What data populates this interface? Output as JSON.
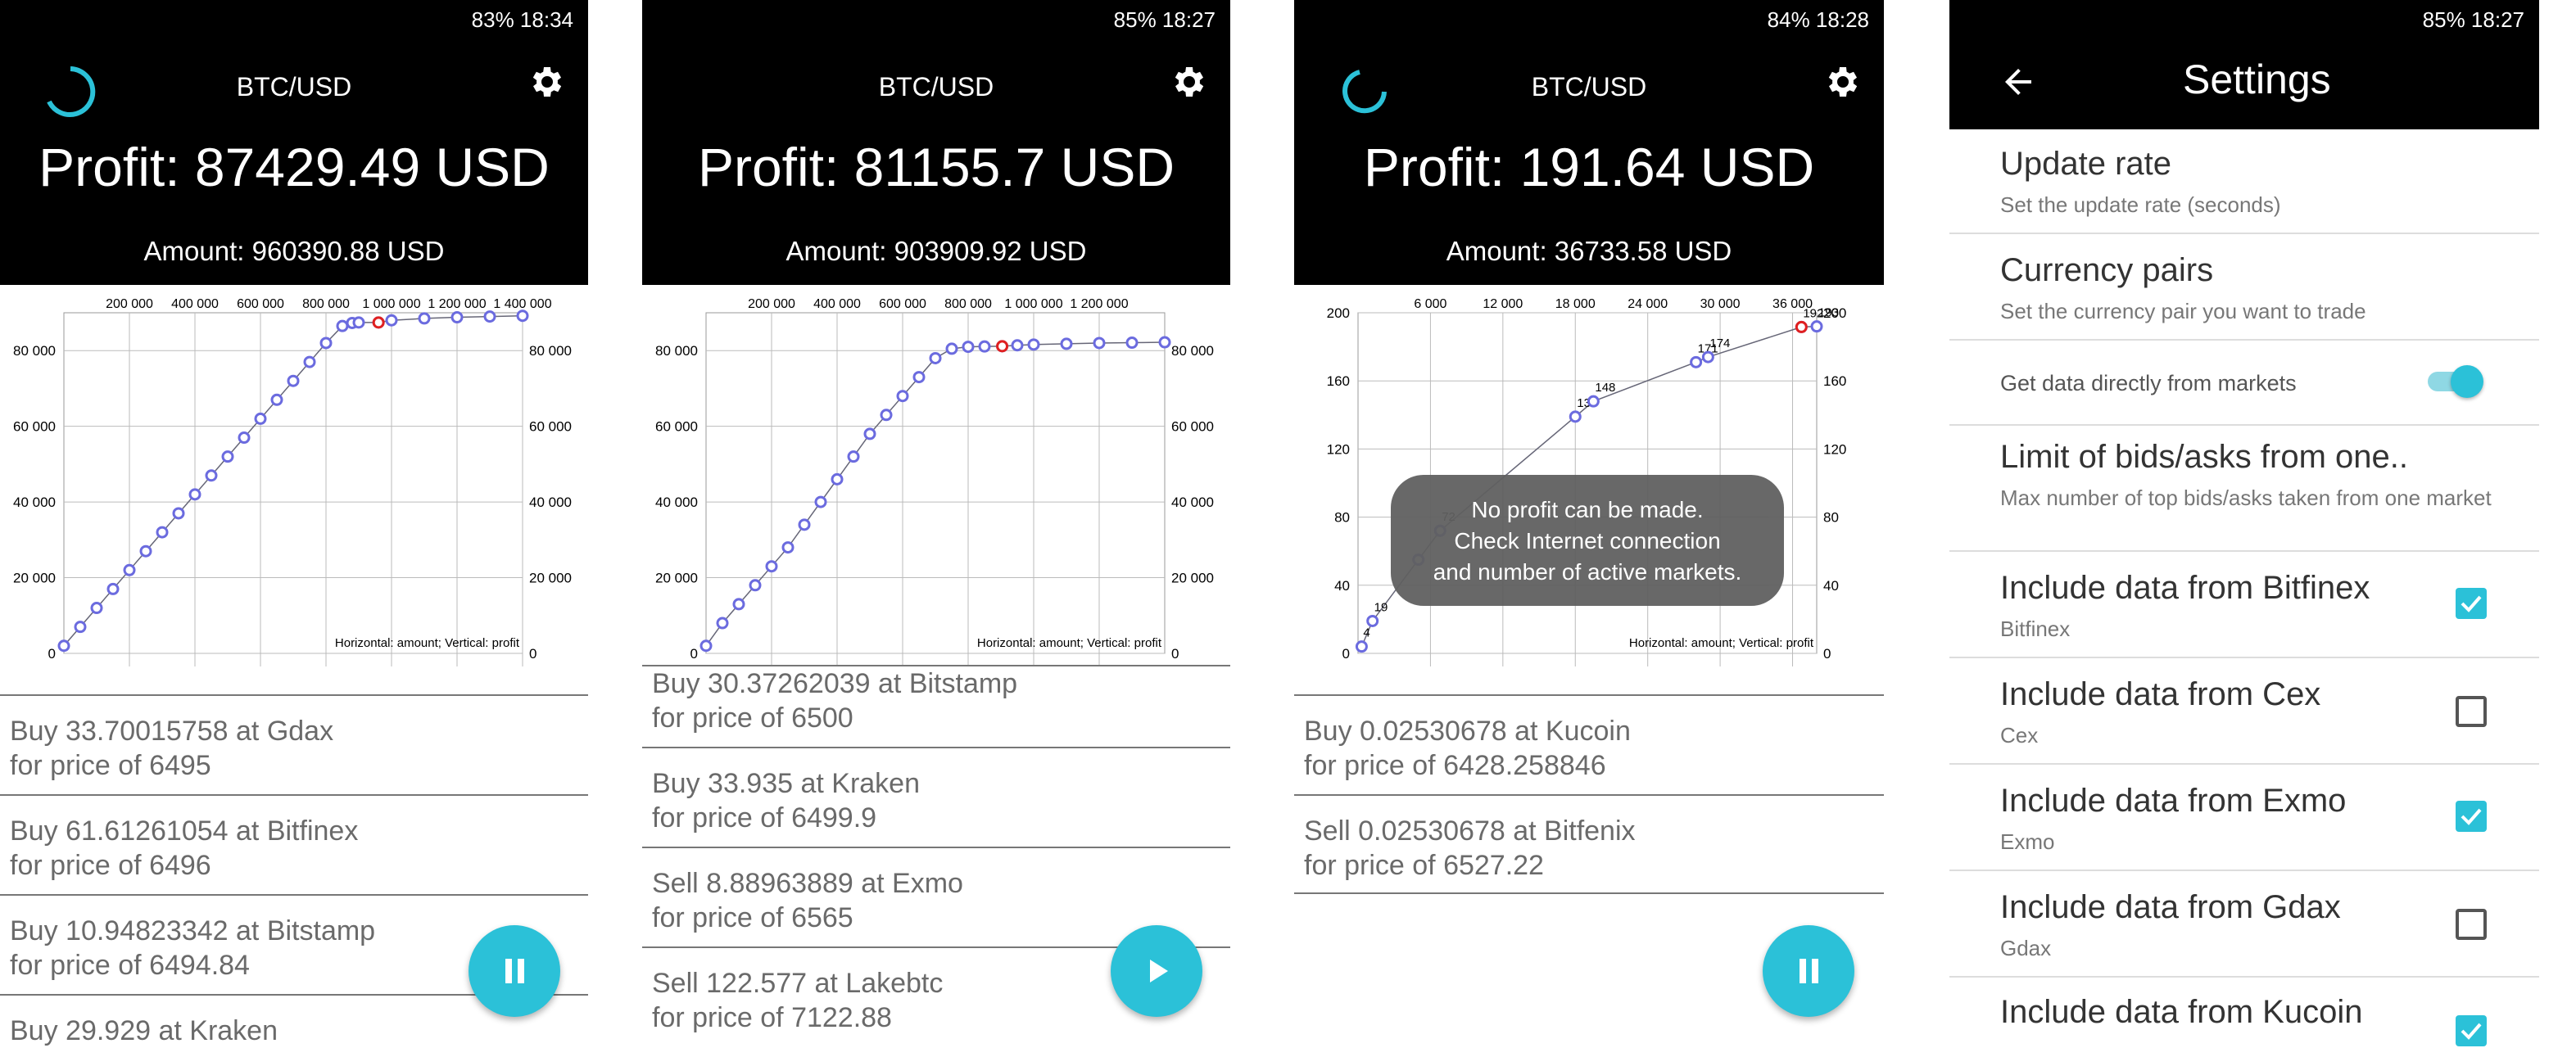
{
  "screens": [
    {
      "status": "83% 18:34",
      "pair": "BTC/USD",
      "profit": "Profit: 87429.49 USD",
      "amount": "Amount: 960390.88 USD",
      "chart_note": "Horizontal: amount; Vertical: profit",
      "trades": [
        {
          "line1": "Buy 33.70015758 at Gdax",
          "line2": "for price of 6495"
        },
        {
          "line1": "Buy 61.61261054 at Bitfinex",
          "line2": "for price of 6496"
        },
        {
          "line1": "Buy 10.94823342 at Bitstamp",
          "line2": "for price of 6494.84"
        },
        {
          "line1": "Buy 29.929 at Kraken",
          "line2": ""
        }
      ]
    },
    {
      "status": "85% 18:27",
      "pair": "BTC/USD",
      "profit": "Profit: 81155.7 USD",
      "amount": "Amount: 903909.92 USD",
      "chart_note": "Horizontal: amount; Vertical: profit",
      "trades": [
        {
          "line1": "Buy 30.37262039 at Bitstamp",
          "line2": "for price of 6500"
        },
        {
          "line1": "Buy 33.935 at Kraken",
          "line2": "for price of 6499.9"
        },
        {
          "line1": "Sell 8.88963889 at Exmo",
          "line2": "for price of 6565"
        },
        {
          "line1": "Sell 122.577 at Lakebtc",
          "line2": "for price of 7122.88"
        }
      ]
    },
    {
      "status": "84% 18:28",
      "pair": "BTC/USD",
      "profit": "Profit: 191.64 USD",
      "amount": "Amount: 36733.58 USD",
      "chart_note": "Horizontal: amount; Vertical: profit",
      "toast": [
        "No profit can be made.",
        "Check Internet connection",
        "and number of active markets."
      ],
      "trades": [
        {
          "line1": "Buy 0.02530678 at Kucoin",
          "line2": "for price of 6428.258846"
        },
        {
          "line1": "Sell 0.02530678 at Bitfenix",
          "line2": "for price of 6527.22"
        }
      ]
    }
  ],
  "settings": {
    "status": "85% 18:27",
    "title": "Settings",
    "items": [
      {
        "title": "Update rate",
        "sub": "Set the update rate (seconds)"
      },
      {
        "title": "Currency pairs",
        "sub": "Set the currency pair you want to trade"
      },
      {
        "title": "Get data directly from markets",
        "toggle": true
      },
      {
        "title": "Limit of bids/asks from one..",
        "sub": "Max number of top bids/asks taken from one market"
      },
      {
        "title": "Include data from Bitfinex",
        "sub": "Bitfinex",
        "checked": true
      },
      {
        "title": "Include data from Cex",
        "sub": "Cex",
        "checked": false
      },
      {
        "title": "Include data from Exmo",
        "sub": "Exmo",
        "checked": true
      },
      {
        "title": "Include data from Gdax",
        "sub": "Gdax",
        "checked": false
      },
      {
        "title": "Include data from Kucoin",
        "sub": "",
        "checked": true
      }
    ]
  },
  "chart_data": [
    {
      "type": "scatter",
      "x_ticks": [
        "200 000",
        "400 000",
        "600 000",
        "800 000",
        "1 000 000",
        "1 200 000",
        "1 400 000"
      ],
      "y_ticks": [
        "0",
        "20 000",
        "40 000",
        "60 000",
        "80 000"
      ],
      "xlim": [
        0,
        1400000
      ],
      "ylim": [
        0,
        90000
      ],
      "x": [
        0,
        50000,
        100000,
        150000,
        200000,
        250000,
        300000,
        350000,
        400000,
        450000,
        500000,
        550000,
        600000,
        650000,
        700000,
        750000,
        800000,
        850000,
        880000,
        900000,
        960390,
        1000000,
        1100000,
        1200000,
        1300000,
        1400000
      ],
      "y": [
        2000,
        7000,
        12000,
        17000,
        22000,
        27000,
        32000,
        37000,
        42000,
        47000,
        52000,
        57000,
        62000,
        67000,
        72000,
        77000,
        82000,
        86500,
        87300,
        87429,
        87429,
        88000,
        88500,
        88800,
        89000,
        89200
      ],
      "highlight_x": 960390,
      "highlight_y": 87429
    },
    {
      "type": "scatter",
      "x_ticks": [
        "200 000",
        "400 000",
        "600 000",
        "800 000",
        "1 000 000",
        "1 200 000"
      ],
      "y_ticks": [
        "0",
        "20 000",
        "40 000",
        "60 000",
        "80 000"
      ],
      "xlim": [
        0,
        1400000
      ],
      "ylim": [
        0,
        90000
      ],
      "x": [
        0,
        50000,
        100000,
        150000,
        200000,
        250000,
        300000,
        350000,
        400000,
        450000,
        500000,
        550000,
        600000,
        650000,
        700000,
        750000,
        800000,
        850000,
        903909,
        950000,
        1000000,
        1100000,
        1200000,
        1300000,
        1400000
      ],
      "y": [
        2000,
        8000,
        13000,
        18000,
        23000,
        28000,
        34000,
        40000,
        46000,
        52000,
        58000,
        63000,
        68000,
        73000,
        78000,
        80500,
        81000,
        81100,
        81155,
        81400,
        81600,
        81800,
        82000,
        82100,
        82200
      ],
      "highlight_x": 903909,
      "highlight_y": 81155
    },
    {
      "type": "scatter",
      "x_ticks": [
        "6 000",
        "12 000",
        "18 000",
        "24 000",
        "30 000",
        "36 000"
      ],
      "y_ticks": [
        "0",
        "40",
        "80",
        "120",
        "160",
        "200"
      ],
      "xlim": [
        0,
        38000
      ],
      "ylim": [
        0,
        200
      ],
      "x": [
        300,
        1200,
        5000,
        6800,
        18000,
        19500,
        28000,
        29000,
        36733,
        38000
      ],
      "y": [
        4,
        19,
        55,
        72,
        139,
        148,
        171,
        174,
        191.64,
        192
      ],
      "labels": [
        "4",
        "19",
        "",
        "72",
        "139",
        "148",
        "171",
        "174",
        "192",
        "193"
      ],
      "highlight_x": 36733,
      "highlight_y": 191.64
    }
  ],
  "colors": {
    "accent": "#2bc1d8",
    "point": "#6b6bdf",
    "highlight": "#e02020"
  }
}
